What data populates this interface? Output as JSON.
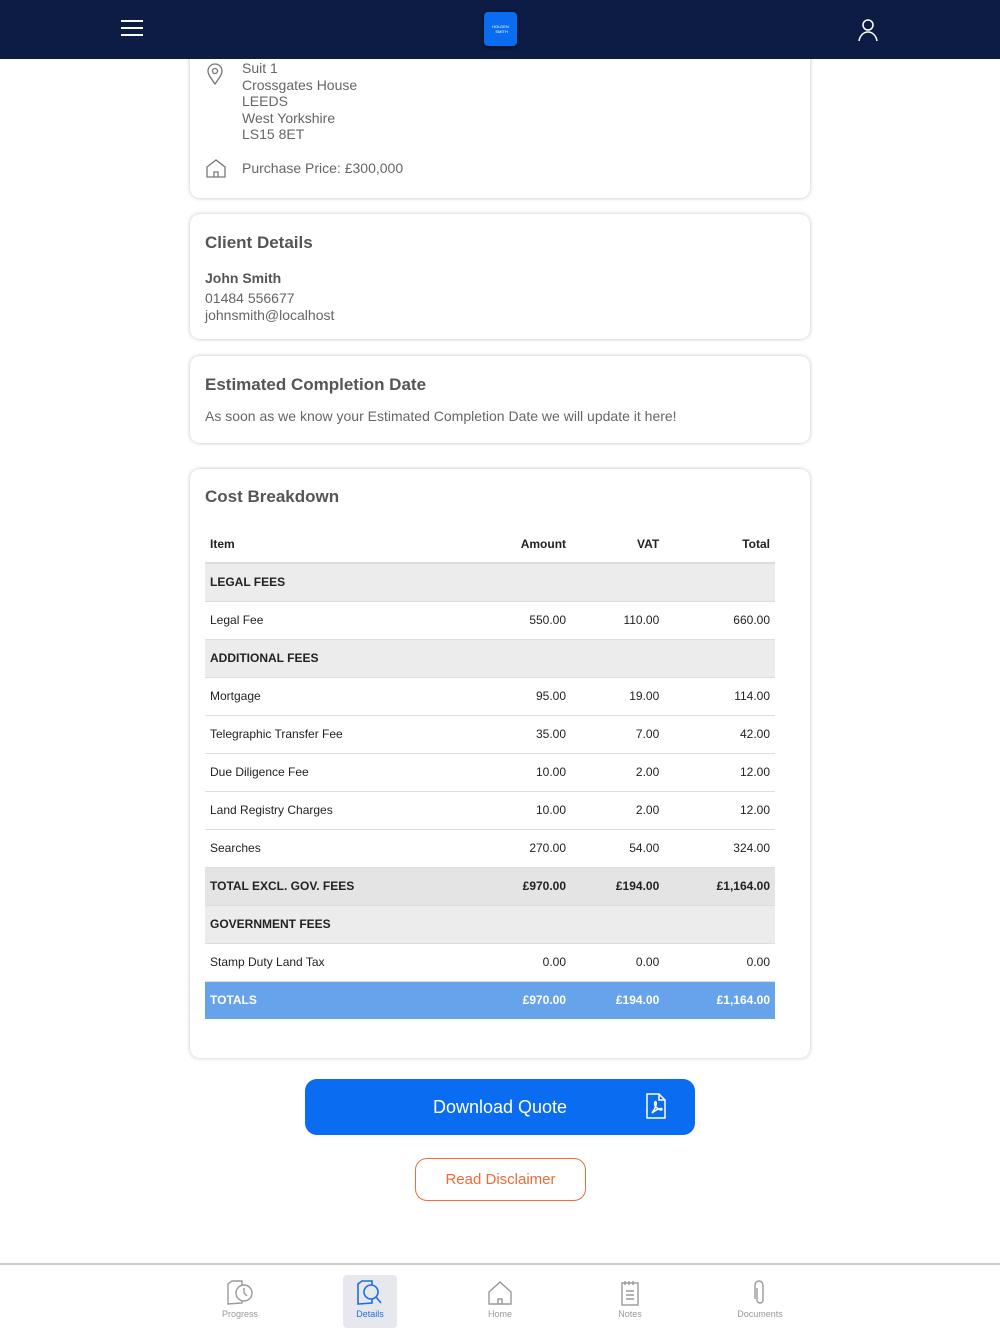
{
  "header": {
    "logo_text": "HOLDEN SMITH"
  },
  "property": {
    "address_lines": [
      "Suit 1",
      "Crossgates House",
      "LEEDS",
      "West Yorkshire",
      "LS15 8ET"
    ],
    "purchase_price": "Purchase Price: £300,000"
  },
  "client": {
    "title": "Client Details",
    "name": "John Smith",
    "phone": "01484 556677",
    "email": "johnsmith@localhost"
  },
  "completion": {
    "title": "Estimated Completion Date",
    "text": "As soon as we know your Estimated Completion Date we will update it here!"
  },
  "costs": {
    "title": "Cost Breakdown",
    "headers": [
      "Item",
      "Amount",
      "VAT",
      "Total"
    ],
    "rows": [
      {
        "type": "sec",
        "cells": [
          "LEGAL FEES",
          "",
          "",
          ""
        ]
      },
      {
        "type": "row",
        "cells": [
          "Legal Fee",
          "550.00",
          "110.00",
          "660.00"
        ]
      },
      {
        "type": "sec",
        "cells": [
          "ADDITIONAL FEES",
          "",
          "",
          ""
        ]
      },
      {
        "type": "row",
        "cells": [
          "Mortgage",
          "95.00",
          "19.00",
          "114.00"
        ]
      },
      {
        "type": "row",
        "cells": [
          "Telegraphic Transfer Fee",
          "35.00",
          "7.00",
          "42.00"
        ]
      },
      {
        "type": "row",
        "cells": [
          "Due Diligence Fee",
          "10.00",
          "2.00",
          "12.00"
        ]
      },
      {
        "type": "row",
        "cells": [
          "Land Registry Charges",
          "10.00",
          "2.00",
          "12.00"
        ]
      },
      {
        "type": "row",
        "cells": [
          "Searches",
          "270.00",
          "54.00",
          "324.00"
        ]
      },
      {
        "type": "sub",
        "cells": [
          "TOTAL EXCL. GOV. FEES",
          "£970.00",
          "£194.00",
          "£1,164.00"
        ]
      },
      {
        "type": "sec",
        "cells": [
          "GOVERNMENT FEES",
          "",
          "",
          ""
        ]
      },
      {
        "type": "row",
        "cells": [
          "Stamp Duty Land Tax",
          "0.00",
          "0.00",
          "0.00"
        ]
      },
      {
        "type": "tot",
        "cells": [
          "TOTALS",
          "£970.00",
          "£194.00",
          "£1,164.00"
        ]
      }
    ]
  },
  "actions": {
    "download": "Download Quote",
    "disclaimer": "Read Disclaimer"
  },
  "tabs": [
    {
      "label": "Progress"
    },
    {
      "label": "Details"
    },
    {
      "label": "Home"
    },
    {
      "label": "Notes"
    },
    {
      "label": "Documents"
    }
  ]
}
